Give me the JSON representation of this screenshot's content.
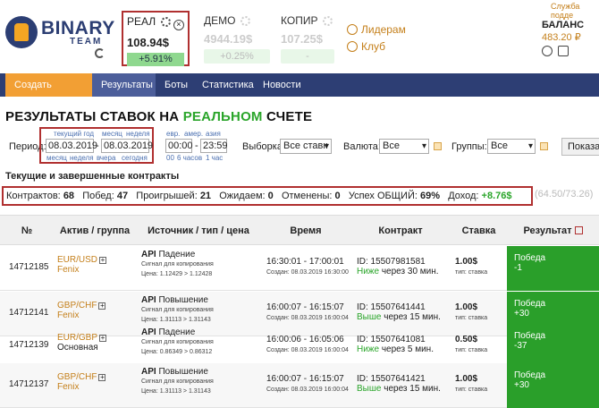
{
  "header": {
    "logo_main": "BINARY",
    "logo_sub": "TEAM",
    "support_link": "Служба подде",
    "accounts": [
      {
        "name": "РЕАЛ",
        "value": "108.94$",
        "pct": "+5.91%"
      },
      {
        "name": "ДЕМО",
        "value": "4944.19$",
        "pct": "+0.25%"
      },
      {
        "name": "КОПИР",
        "value": "107.25$",
        "pct": "-"
      }
    ],
    "links": {
      "leaders": "Лидерам",
      "club": "Клуб"
    },
    "balance": {
      "label": "БАЛАНС",
      "value": "483.20 ₽"
    }
  },
  "nav": {
    "create": "Создать контракт",
    "results": "Результаты",
    "bots": "Боты",
    "stats": "Статистика",
    "news": "Новости"
  },
  "page": {
    "title_pre": "РЕЗУЛЬТАТЫ СТАВОК НА ",
    "title_green": "РЕАЛЬНОМ",
    "title_post": " СЧЕТЕ"
  },
  "filters": {
    "period_label": "Период:",
    "date_from": "08.03.2019",
    "date_to": "08.03.2019",
    "quick_top": [
      "текущий год",
      "месяц",
      "неделя"
    ],
    "quick_bottom": [
      "месяц",
      "неделя",
      "вчера",
      "сегодня"
    ],
    "sessions": [
      "евр.",
      "амер.",
      "азия"
    ],
    "time_from": "00:00",
    "time_to": "23:59",
    "time_quick": [
      "00",
      "6 часов",
      "1 час"
    ],
    "selection_label": "Выборка:",
    "selection_value": "Все ставк",
    "currency_label": "Валюта:",
    "currency_value": "Все",
    "groups_label": "Группы:",
    "groups_value": "Все",
    "show_button": "Показат"
  },
  "summary": {
    "subtitle": "Текущие и завершенные контракты",
    "contracts_label": "Контрактов:",
    "contracts": "68",
    "wins_label": "Побед:",
    "wins": "47",
    "losses_label": "Проигрышей:",
    "losses": "21",
    "waiting_label": "Ожидаем:",
    "waiting": "0",
    "canceled_label": "Отменены:",
    "canceled": "0",
    "success_label": "Успех ОБЩИЙ:",
    "success": "69%",
    "income_label": "Доход:",
    "income": "+8.76$",
    "extra": "(64.50/73.26)"
  },
  "table": {
    "headers": [
      "№",
      "Актив / группа",
      "Источник / тип / цена",
      "Время",
      "Контракт",
      "Ставка",
      "Результат"
    ],
    "rows": [
      {
        "id": "14712185",
        "asset": "EUR/USD",
        "group": "Fenix",
        "source": "API",
        "dir": "Падение",
        "signal": "Сигнал для копирования",
        "price": "Цена: 1.12429 > 1.12428",
        "time": "16:30:01 - 17:00:01",
        "created": "Создан: 08.03.2019 16:30:00",
        "contract_id": "ID: 15507981581",
        "dir_word": "Ниже",
        "expiry": " через 30 мин.",
        "stake": "1.00$",
        "stake_type": "тип: ставка",
        "result": "Победа",
        "result_val": "-1"
      },
      {
        "id": "14712141",
        "asset": "GBP/CHF",
        "group": "Fenix",
        "source": "API",
        "dir": "Повышение",
        "signal": "Сигнал для копирования",
        "price": "Цена: 1.31113 > 1.31143",
        "time": "16:00:07 - 16:15:07",
        "created": "Создан: 08.03.2019 16:00:04",
        "contract_id": "ID: 15507641441",
        "dir_word": "Выше",
        "expiry": " через 15 мин.",
        "stake": "1.00$",
        "stake_type": "тип: ставка",
        "result": "Победа",
        "result_val": "+30"
      },
      {
        "id": "14712139",
        "asset": "EUR/GBP",
        "group": "Основная",
        "source": "API",
        "dir": "Падение",
        "signal": "Сигнал для копирования",
        "price": "Цена: 0.86349 > 0.86312",
        "time": "16:00:06 - 16:05:06",
        "created": "Создан: 08.03.2019 16:00:04",
        "contract_id": "ID: 15507641081",
        "dir_word": "Ниже",
        "expiry": " через 5 мин.",
        "stake": "0.50$",
        "stake_type": "тип: ставка",
        "result": "Победа",
        "result_val": "-37"
      },
      {
        "id": "14712137",
        "asset": "GBP/CHF",
        "group": "Fenix",
        "source": "API",
        "dir": "Повышение",
        "signal": "Сигнал для копирования",
        "price": "Цена: 1.31113 > 1.31143",
        "time": "16:00:07 - 16:15:07",
        "created": "Создан: 08.03.2019 16:00:04",
        "contract_id": "ID: 15507641421",
        "dir_word": "Выше",
        "expiry": " через 15 мин.",
        "stake": "1.00$",
        "stake_type": "тип: ставка",
        "result": "Победа",
        "result_val": "+30"
      }
    ]
  },
  "colors": {
    "nav": "#2d3e74",
    "accent": "#f29f34",
    "win": "#2a9f2a",
    "link": "#c47f1a"
  }
}
